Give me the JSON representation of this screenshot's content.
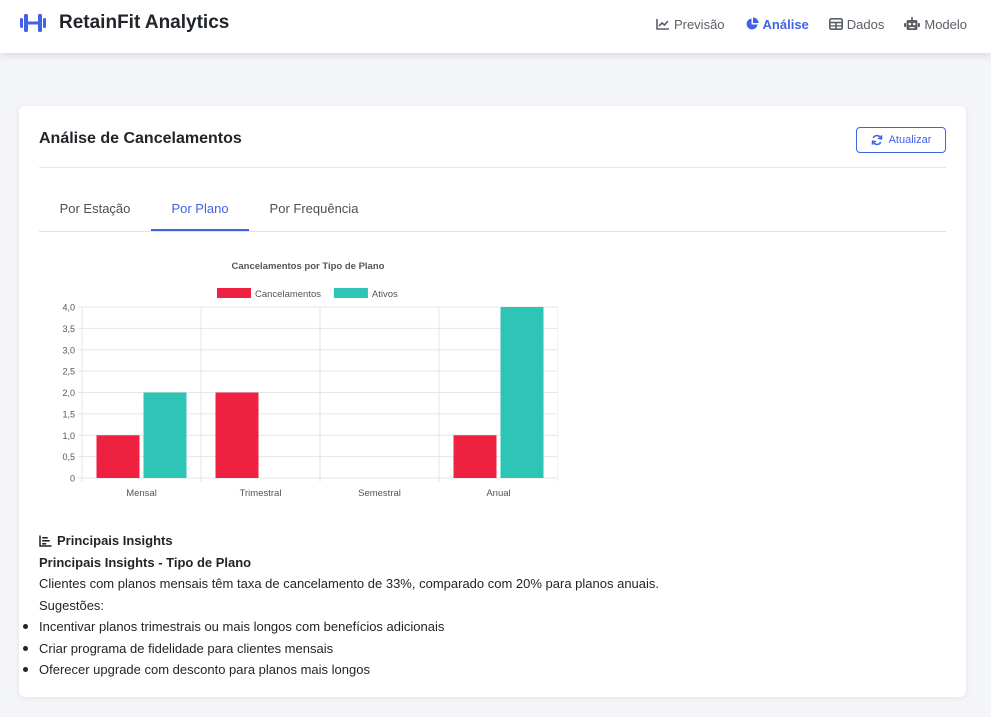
{
  "app": {
    "name": "RetainFit Analytics",
    "brand_color": "#4262e6"
  },
  "nav": {
    "items": [
      {
        "label": "Previsão",
        "icon": "line-chart-icon",
        "active": false
      },
      {
        "label": "Análise",
        "icon": "pie-chart-icon",
        "active": true
      },
      {
        "label": "Dados",
        "icon": "table-icon",
        "active": false
      },
      {
        "label": "Modelo",
        "icon": "robot-icon",
        "active": false
      }
    ]
  },
  "card": {
    "title": "Análise de Cancelamentos",
    "refresh_label": "Atualizar"
  },
  "tabs": [
    {
      "label": "Por Estação",
      "active": false
    },
    {
      "label": "Por Plano",
      "active": true
    },
    {
      "label": "Por Frequência",
      "active": false
    }
  ],
  "chart_data": {
    "type": "bar",
    "title": "Cancelamentos por Tipo de Plano",
    "categories": [
      "Mensal",
      "Trimestral",
      "Semestral",
      "Anual"
    ],
    "series": [
      {
        "name": "Cancelamentos",
        "color": "#ee2140",
        "values": [
          1,
          2,
          0,
          1
        ]
      },
      {
        "name": "Ativos",
        "color": "#2ec4b6",
        "values": [
          2,
          0,
          0,
          4
        ]
      }
    ],
    "ylim": [
      0,
      4
    ],
    "yticks": [
      "4,0",
      "3,5",
      "3,0",
      "2,5",
      "2,0",
      "1,5",
      "1,0",
      "0,5",
      "0"
    ],
    "grid": true,
    "legend": "top"
  },
  "insights": {
    "heading": "Principais Insights",
    "subtitle": "Principais Insights - Tipo de Plano",
    "text": "Clientes com planos mensais têm taxa de cancelamento de 33%, comparado com 20% para planos anuais.",
    "suggestions_label": "Sugestões:",
    "suggestions": [
      "Incentivar planos trimestrais ou mais longos com benefícios adicionais",
      "Criar programa de fidelidade para clientes mensais",
      "Oferecer upgrade com desconto para planos mais longos"
    ]
  }
}
